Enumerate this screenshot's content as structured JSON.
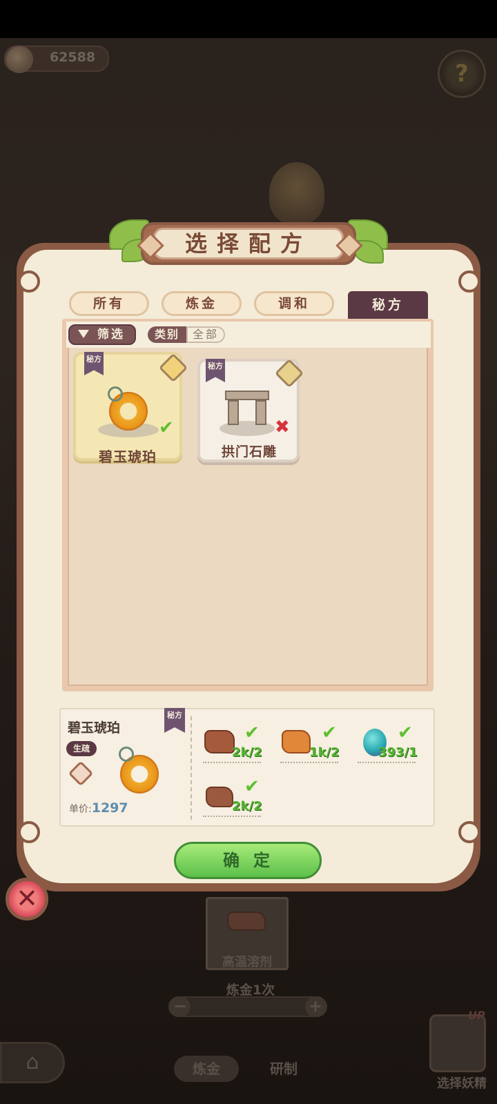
{
  "currency": {
    "value": "62588"
  },
  "help": {
    "icon": "question-icon",
    "glyph": "?"
  },
  "dialog": {
    "title": "选择配方",
    "tabs": [
      {
        "label": "所有",
        "active": false
      },
      {
        "label": "炼金",
        "active": false
      },
      {
        "label": "调和",
        "active": false
      },
      {
        "label": "秘方",
        "active": true
      }
    ],
    "filter": {
      "button_label": "筛选",
      "category_label": "类别",
      "category_value": "全部"
    },
    "recipes": [
      {
        "name": "碧玉琥珀",
        "tag": "秘方",
        "available": true,
        "selected": true
      },
      {
        "name": "拱门石雕",
        "tag": "秘方",
        "available": false,
        "selected": false
      }
    ],
    "detail": {
      "name": "碧玉琥珀",
      "badge": "生疏",
      "tag": "秘方",
      "price_label": "单价:",
      "price_value": "1297",
      "ingredients": [
        {
          "icon": "copper-ore-icon",
          "count": "2k/2",
          "ok": true
        },
        {
          "icon": "fire-crystal-icon",
          "count": "1k/2",
          "ok": true
        },
        {
          "icon": "blue-fruit-icon",
          "count": "393/1",
          "ok": true
        },
        {
          "icon": "wood-block-icon",
          "count": "2k/2",
          "ok": true
        }
      ]
    },
    "confirm_label": "确定"
  },
  "background": {
    "current_recipe_label": "高温溶剂",
    "alchemy_count_label": "炼金1次",
    "bottom_tabs": [
      "炼金",
      "研制"
    ],
    "fairy_label": "选择妖精",
    "up_tag": "UP"
  },
  "colors": {
    "panel_frame": "#8a5a45",
    "panel_fill": "#f4ecd8",
    "active_tab": "#5a3944",
    "confirm_green": "#5cc04a",
    "check_green": "#5fbf2f",
    "cross_red": "#d6333a",
    "price_blue": "#5c8db0"
  }
}
